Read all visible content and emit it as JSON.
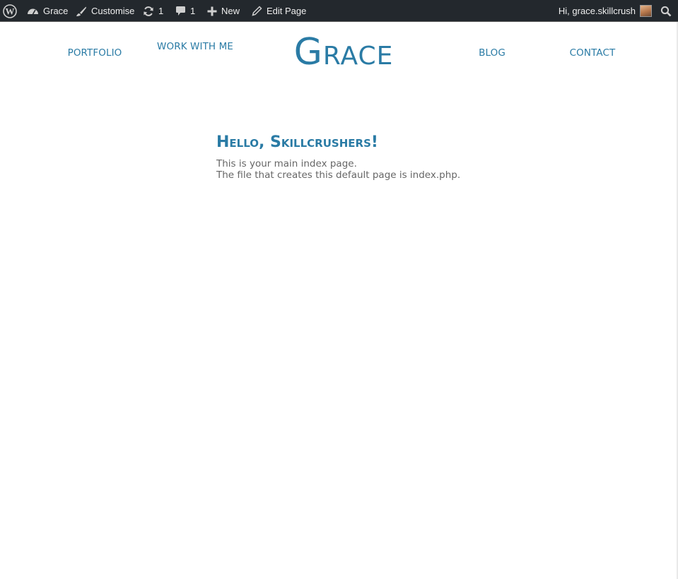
{
  "admin_bar": {
    "wp_logo": "wordpress-icon",
    "site": {
      "icon": "dashboard-icon",
      "label": "Grace"
    },
    "customise": {
      "icon": "brush-icon",
      "label": "Customise"
    },
    "updates": {
      "icon": "refresh-icon",
      "count": "1"
    },
    "comments": {
      "icon": "comment-icon",
      "count": "1"
    },
    "new": {
      "icon": "plus-icon",
      "label": "New"
    },
    "edit_page": {
      "icon": "pencil-icon",
      "label": "Edit Page"
    },
    "account": {
      "greeting": "Hi, grace.skillcrush",
      "avatar": "avatar"
    },
    "search": {
      "icon": "search-icon"
    }
  },
  "header": {
    "nav_left": [
      "PORTFOLIO",
      "WORK WITH ME"
    ],
    "logo": "Grace",
    "nav_right": [
      "BLOG",
      "CONTACT"
    ]
  },
  "content": {
    "title": "Hello, Skillcrushers!",
    "lines": [
      "This is your main index page.",
      "The file that creates this default page is index.php."
    ]
  },
  "colors": {
    "accent": "#2a7ba5",
    "admin_bar_bg": "#23282d",
    "body_text": "#666666",
    "page_bg": "#ffffff"
  }
}
